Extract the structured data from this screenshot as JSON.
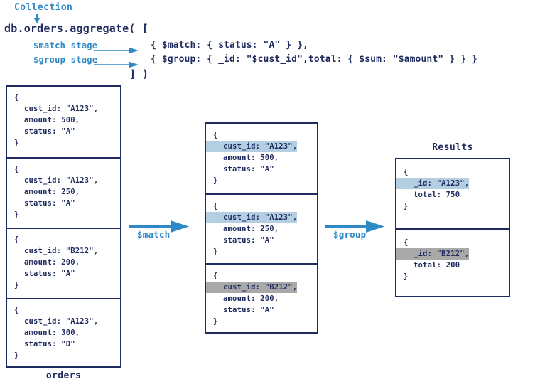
{
  "header": {
    "collection_label": "Collection",
    "collection_arrow_icon": "arrow-down-icon",
    "aggregate_call": "db.orders.aggregate( [",
    "match_stage_label": "$match stage",
    "group_stage_label": "$group stage",
    "match_stage_arrow_icon": "arrow-right-icon",
    "group_stage_arrow_icon": "arrow-right-icon",
    "code_match_line": "{ $match: { status: \"A\" } },",
    "code_group_line": "{ $group: { _id: \"$cust_id\",total: { $sum: \"$amount\" } } }",
    "code_close_line": "] )"
  },
  "collection": {
    "caption": "orders",
    "documents": [
      {
        "open_brace": "{",
        "cust_id": "cust_id: \"A123\",",
        "amount": "amount: 500,",
        "status": "status: \"A\"",
        "close_brace": "}"
      },
      {
        "open_brace": "{",
        "cust_id": "cust_id: \"A123\",",
        "amount": "amount: 250,",
        "status": "status: \"A\"",
        "close_brace": "}"
      },
      {
        "open_brace": "{",
        "cust_id": "cust_id: \"B212\",",
        "amount": "amount: 200,",
        "status": "status: \"A\"",
        "close_brace": "}"
      },
      {
        "open_brace": "{",
        "cust_id": "cust_id: \"A123\",",
        "amount": "amount: 300,",
        "status": "status: \"D\"",
        "close_brace": "}"
      }
    ]
  },
  "match_stage": {
    "arrow_label": "$match",
    "arrow_icon": "arrow-right-icon",
    "documents": [
      {
        "open_brace": "{",
        "cust_id": "cust_id: \"A123\",",
        "amount": "amount: 500,",
        "status": "status: \"A\"",
        "close_brace": "}",
        "highlight": "blue"
      },
      {
        "open_brace": "{",
        "cust_id": "cust_id: \"A123\",",
        "amount": "amount: 250,",
        "status": "status: \"A\"",
        "close_brace": "}",
        "highlight": "blue"
      },
      {
        "open_brace": "{",
        "cust_id": "cust_id: \"B212\",",
        "amount": "amount: 200,",
        "status": "status: \"A\"",
        "close_brace": "}",
        "highlight": "gray"
      }
    ]
  },
  "group_stage": {
    "arrow_label": "$group",
    "arrow_icon": "arrow-right-icon"
  },
  "results": {
    "caption": "Results",
    "documents": [
      {
        "open_brace": "{",
        "id": "_id: \"A123\",",
        "total": "total: 750",
        "close_brace": "}",
        "highlight": "blue"
      },
      {
        "open_brace": "{",
        "id": "_id: \"B212\",",
        "total": "total: 200",
        "close_brace": "}",
        "highlight": "gray"
      }
    ]
  },
  "colors": {
    "navy": "#1f2a5e",
    "accent_blue": "#2f89c6",
    "highlight_blue": "#b4cee2",
    "highlight_gray": "#a9a9a9",
    "background": "#ffffff"
  }
}
